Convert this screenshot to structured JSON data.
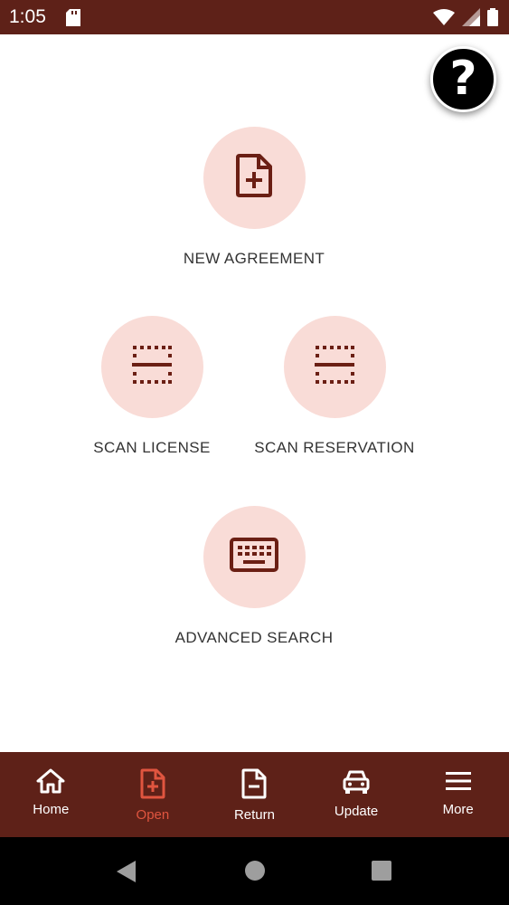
{
  "status_bar": {
    "time": "1:05"
  },
  "actions": {
    "new_agreement": "NEW AGREEMENT",
    "scan_license": "SCAN LICENSE",
    "scan_reservation": "SCAN RESERVATION",
    "advanced_search": "ADVANCED SEARCH"
  },
  "bottom_nav": {
    "items": [
      {
        "label": "Home",
        "icon": "home-icon"
      },
      {
        "label": "Open",
        "icon": "file-plus-icon",
        "active": true
      },
      {
        "label": "Return",
        "icon": "file-minus-icon"
      },
      {
        "label": "Update",
        "icon": "car-icon"
      },
      {
        "label": "More",
        "icon": "menu-icon"
      }
    ]
  },
  "colors": {
    "primary": "#5e2118",
    "accent": "#e0553f",
    "circle_bg": "#f9dcd7",
    "icon": "#6b1f14"
  }
}
